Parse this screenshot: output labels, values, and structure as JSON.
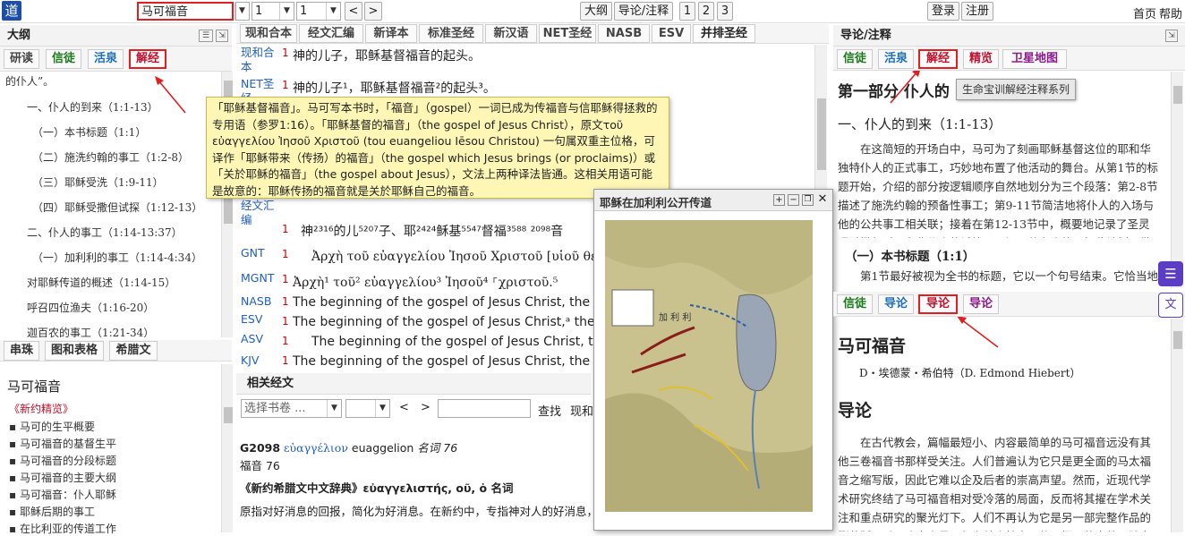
{
  "toolbar": {
    "logo": "道",
    "book": "马可福音",
    "chapter": "1",
    "verse": "1",
    "prev": "<",
    "next": ">",
    "outline_btn": "大纲",
    "intro_btn": "导论/注释",
    "p1": "1",
    "p2": "2",
    "p3": "3",
    "login": "登录",
    "register": "注册",
    "home": "首页",
    "help": "帮助"
  },
  "left": {
    "title": "大纲",
    "tabs": [
      "研读",
      "信徒",
      "活泉",
      "解经"
    ],
    "outline": [
      "的仆人”。",
      "一、仆人的到来（1:1-13）",
      "（一）本书标题（1:1）",
      "（二）施洗约翰的事工（1:2-8）",
      "（三）耶稣受洗（1:9-11）",
      "（四）耶稣受撒但试探（1:12-13）",
      "二、仆人的事工（1:14-13:37）",
      "（一）加利利的事工（1:14-4:34）",
      "对耶稣传道的概述（1:14-15）",
      "呼召四位渔夫（1:16-20）",
      "迦百农的事工（1:21-34）"
    ],
    "bottom_tabs": [
      "串珠",
      "图和表格",
      "希腊文"
    ],
    "bottom_title": "马可福音",
    "bottom_link": "《新约精览》",
    "bottom_items": [
      "马可的生平概要",
      "马可福音的基督生平",
      "马可福音的分段标题",
      "马可福音的主要大纲",
      "马可福音：仆人耶稣",
      "耶稣后期的事工",
      "在比利亚的传道工作"
    ]
  },
  "center": {
    "tabs": [
      "现和合本",
      "经文汇编",
      "新译本",
      "标准圣经",
      "新汉语",
      "NET圣经",
      "NASB",
      "ESV",
      "并排圣经"
    ],
    "verses": [
      {
        "name": "现和合本",
        "num": "1",
        "text": "神的儿子，耶稣基督福音的起头。"
      },
      {
        "name": "NET圣经",
        "num": "1",
        "text": "神的儿子¹，耶稣基督福音²的起头³。"
      },
      {
        "name": "经文汇编",
        "num": "1",
        "text": "神²³¹⁶的儿⁵²⁰⁷子、耶²⁴²⁴稣基⁵⁵⁴⁷督福³⁵⁸⁸ ²⁰⁹⁸音"
      },
      {
        "name": "GNT",
        "num": "1",
        "text": "Ἀρχὴ τοῦ εὐαγγελίου Ἰησοῦ Χριστοῦ [υἱοῦ θεοῦ"
      },
      {
        "name": "MGNT",
        "num": "1",
        "text": "Ἀρχὴ¹ τοῦ² εὐαγγελίου³ Ἰησοῦ⁴ ⸀χριστοῦ.⁵"
      },
      {
        "name": "NASB",
        "num": "1",
        "text": "The beginning of the gospel of Jesus Christ, the Son of"
      },
      {
        "name": "ESV",
        "num": "1",
        "text": "The beginning of the gospel of Jesus Christ,ᵃ the Son o"
      },
      {
        "name": "ASV",
        "num": "1",
        "text": "The beginning of the gospel of Jesus Christ, the So"
      },
      {
        "name": "KJV",
        "num": "1",
        "text": "The beginning of the gospel of Jesus Christ, the Son of"
      }
    ],
    "tooltip": "「耶稣基督福音」。马可写本书时，「福音」（gospel）一词已成为传福音与信耶稣得拯救的专用语（参罗1:16）。「耶稣基督的福音」（the gospel of Jesus Christ），原文τοῦ εὐαγγελίου Ἰησοῦ Χριστοῦ (tou euangeliou Iēsou Christou) 一句属双重主位格，可译作「耶稣带来（传扬）的福音」（the gospel which Jesus brings (or proclaims)）或「关於耶稣的福音」（the gospel about Jesus），文法上两种译法皆通。这相关用语可能是故意的：耶稣传扬的福音就是关於耶稣自己的福音。",
    "related_title": "相关经文",
    "related_select": "选择书卷 ...",
    "related_search": "查找",
    "related_version": "现和",
    "strong_id": "G2098",
    "strong_greek": "εὐαγγέλιον",
    "strong_translit": "euaggelion",
    "strong_pos": "名词 76",
    "strong_meaning": "福音 76",
    "dict_title": "《新约希腊文中文辞典》εὐαγγελιστής, οῦ, ὁ 名词",
    "dict_body": "原指对好消息的回报，简化为好消息。在新约中，专指神对人的好消息，"
  },
  "map": {
    "title": "耶稣在加利利公开传道",
    "region": "加 利 利"
  },
  "right": {
    "title": "导论/注释",
    "tabs": [
      "信徒",
      "活泉",
      "解经",
      "精览",
      "卫星地图"
    ],
    "tooltip": "生命宝训解经注释系列",
    "h1": "第一部分 仆人的",
    "h2": "一、仆人的到来（1:1-13）",
    "p1": "在这简短的开场白中，马可为了刻画耶稣基督这位的耶和华独特仆人的正式事工，巧妙地布置了他活动的舞台。从第1节的标题开始，介绍的部分按逻辑顺序自然地划分为三个段落：第2-8节描述了施洗约翰的预备性事工；第9-11节简洁地将仆人的入场与他的公共事工相关联；接着在第12-13节中，概要地记录了圣灵通过撒但对耶和华仆人的试炼，以证明他有资格承担此计划要做的事工。",
    "h3": "（一）本书标题（1:1）",
    "p2": "第1节最好被视为全书的标题，它以一个句号结束。它恰当地",
    "tabs2": [
      "信徒",
      "导论",
      "导论",
      "导论"
    ],
    "book": "马可福音",
    "author": "D・埃德蒙・希伯特（D. Edmond Hiebert）",
    "intro": "导论",
    "p3": "在古代教会，篇幅最短小、内容最简单的马可福音远没有其他三卷福音书那样受关注。人们普遍认为它只是更全面的马太福音之缩写版，因此它难以企及后者的崇高声望。然而，近现代学术研究终结了马可福音相对受冷落的局面，反而将其擢在学术关注和重点研究的聚光灯下。人们不再认为它是另一部完整作品的删节版，反而确定它是一部为某个特定目的而撰写的完整、独立的作品，也是"
  }
}
